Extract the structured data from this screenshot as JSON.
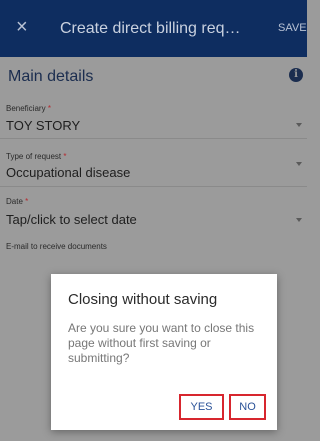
{
  "appbar": {
    "title": "Create direct billing req…",
    "save_label": "SAVE",
    "close_symbol": "×"
  },
  "main": {
    "section_title": "Main details",
    "info_symbol": "i",
    "fields": [
      {
        "label": "Beneficiary",
        "required_mark": "*",
        "value": "TOY STORY"
      },
      {
        "label": "Type of request",
        "required_mark": "*",
        "value": "Occupational disease"
      },
      {
        "label": "Date",
        "required_mark": "*",
        "value": "Tap/click to select date"
      }
    ],
    "email_label": "E-mail to receive documents"
  },
  "dialog": {
    "title": "Closing without saving",
    "message": "Are you sure you want to close this page without first saving or submitting?",
    "yes_label": "YES",
    "no_label": "NO"
  },
  "colors": {
    "appbar_bg": "#0e2d60",
    "accent": "#2a5298",
    "required": "#b5292f",
    "highlight_border": "#d7262e"
  },
  "icons": {
    "close": "close-icon",
    "info": "info-icon",
    "dropdown": "chevron-down-icon"
  }
}
